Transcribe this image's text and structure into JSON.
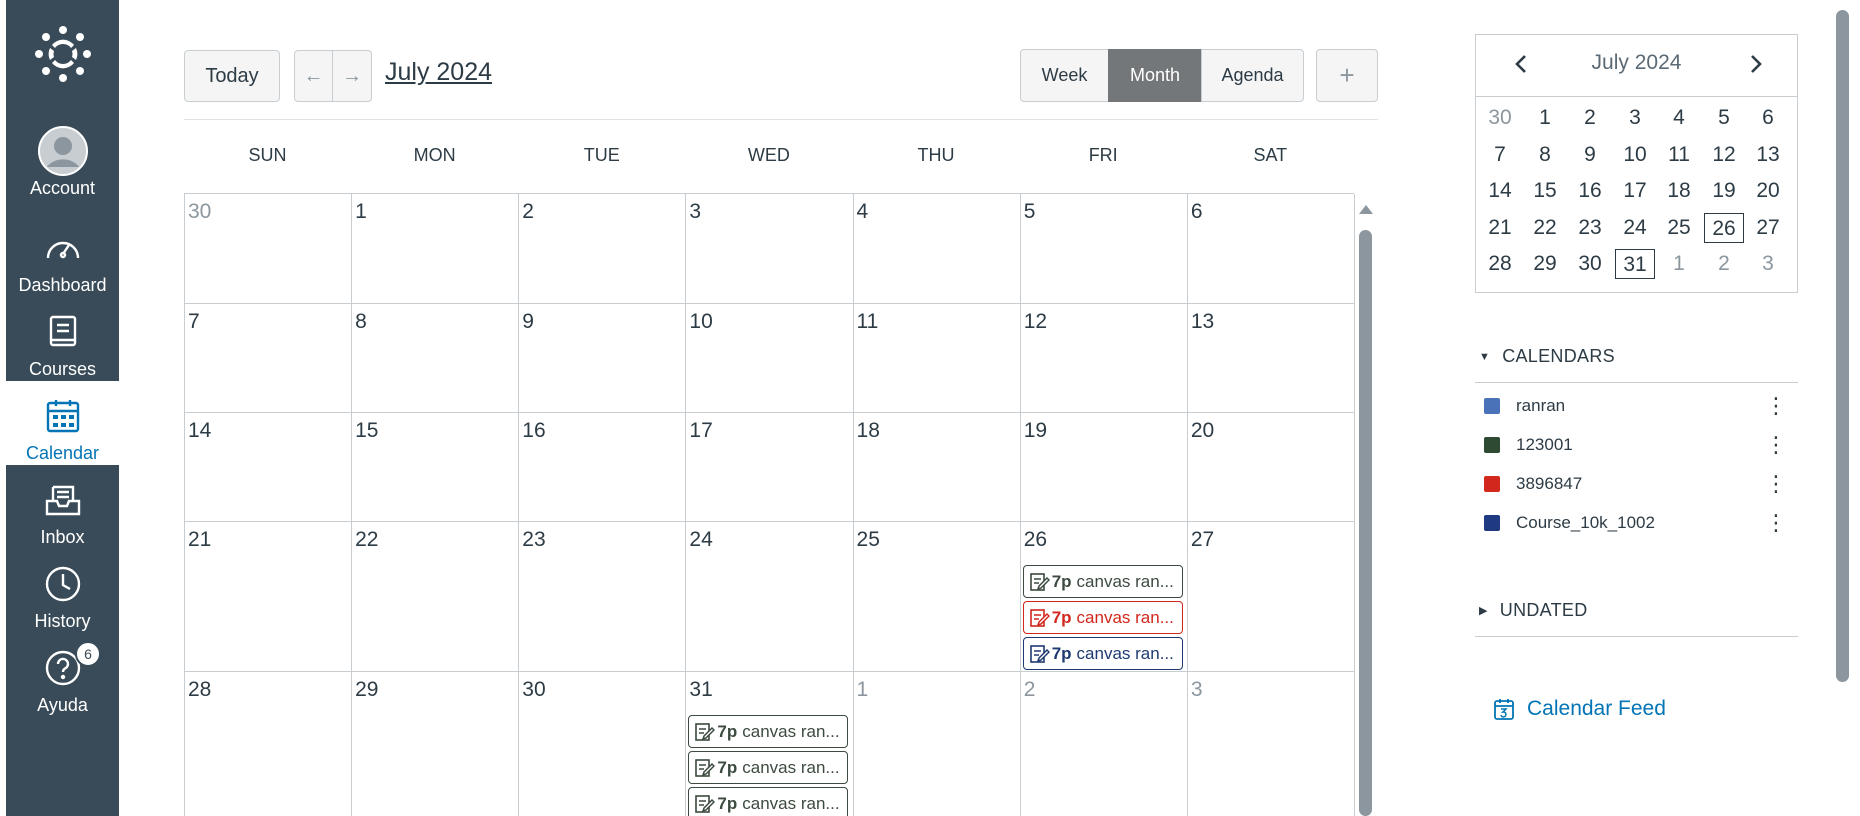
{
  "nav": {
    "items": [
      {
        "key": "account",
        "label": "Account"
      },
      {
        "key": "dashboard",
        "label": "Dashboard"
      },
      {
        "key": "courses",
        "label": "Courses"
      },
      {
        "key": "calendar",
        "label": "Calendar"
      },
      {
        "key": "inbox",
        "label": "Inbox"
      },
      {
        "key": "history",
        "label": "History"
      },
      {
        "key": "help",
        "label": "Ayuda"
      }
    ],
    "help_badge": "6"
  },
  "header": {
    "today_label": "Today",
    "prev_label": "←",
    "next_label": "→",
    "title": "July 2024",
    "week_label": "Week",
    "month_label": "Month",
    "agenda_label": "Agenda",
    "add_label": "+"
  },
  "days_of_week": [
    "SUN",
    "MON",
    "TUE",
    "WED",
    "THU",
    "FRI",
    "SAT"
  ],
  "weeks": [
    [
      {
        "d": "30",
        "other": true
      },
      {
        "d": "1"
      },
      {
        "d": "2"
      },
      {
        "d": "3"
      },
      {
        "d": "4"
      },
      {
        "d": "5"
      },
      {
        "d": "6"
      }
    ],
    [
      {
        "d": "7"
      },
      {
        "d": "8"
      },
      {
        "d": "9"
      },
      {
        "d": "10"
      },
      {
        "d": "11"
      },
      {
        "d": "12"
      },
      {
        "d": "13"
      }
    ],
    [
      {
        "d": "14"
      },
      {
        "d": "15"
      },
      {
        "d": "16"
      },
      {
        "d": "17"
      },
      {
        "d": "18"
      },
      {
        "d": "19"
      },
      {
        "d": "20"
      }
    ],
    [
      {
        "d": "21"
      },
      {
        "d": "22"
      },
      {
        "d": "23"
      },
      {
        "d": "24"
      },
      {
        "d": "25"
      },
      {
        "d": "26",
        "events": [
          {
            "time": "7p",
            "title": "canvas ran...",
            "color": "#3c4a3f"
          },
          {
            "time": "7p",
            "title": "canvas ran...",
            "color": "#d1271c"
          },
          {
            "time": "7p",
            "title": "canvas ran...",
            "color": "#1f3a73"
          }
        ]
      },
      {
        "d": "27"
      }
    ],
    [
      {
        "d": "28"
      },
      {
        "d": "29"
      },
      {
        "d": "30"
      },
      {
        "d": "31",
        "events": [
          {
            "time": "7p",
            "title": "canvas ran...",
            "color": "#3c4a3f"
          },
          {
            "time": "7p",
            "title": "canvas ran...",
            "color": "#3c4a3f"
          },
          {
            "time": "7p",
            "title": "canvas ran...",
            "color": "#3c4a3f"
          }
        ]
      },
      {
        "d": "1",
        "other": true
      },
      {
        "d": "2",
        "other": true
      },
      {
        "d": "3",
        "other": true
      }
    ]
  ],
  "minical": {
    "title": "July 2024",
    "prev_label": "‹",
    "next_label": "›",
    "weeks": [
      [
        {
          "d": "30",
          "other": true
        },
        {
          "d": "1"
        },
        {
          "d": "2"
        },
        {
          "d": "3"
        },
        {
          "d": "4"
        },
        {
          "d": "5"
        },
        {
          "d": "6"
        }
      ],
      [
        {
          "d": "7"
        },
        {
          "d": "8"
        },
        {
          "d": "9"
        },
        {
          "d": "10"
        },
        {
          "d": "11"
        },
        {
          "d": "12"
        },
        {
          "d": "13"
        }
      ],
      [
        {
          "d": "14"
        },
        {
          "d": "15"
        },
        {
          "d": "16"
        },
        {
          "d": "17"
        },
        {
          "d": "18"
        },
        {
          "d": "19"
        },
        {
          "d": "20"
        }
      ],
      [
        {
          "d": "21"
        },
        {
          "d": "22"
        },
        {
          "d": "23"
        },
        {
          "d": "24"
        },
        {
          "d": "25"
        },
        {
          "d": "26",
          "boxed": true
        },
        {
          "d": "27"
        }
      ],
      [
        {
          "d": "28"
        },
        {
          "d": "29"
        },
        {
          "d": "30"
        },
        {
          "d": "31",
          "boxed": true
        },
        {
          "d": "1",
          "other": true
        },
        {
          "d": "2",
          "other": true
        },
        {
          "d": "3",
          "other": true
        }
      ]
    ]
  },
  "calendars": {
    "title": "CALENDARS",
    "items": [
      {
        "name": "ranran",
        "color": "#4a72b8"
      },
      {
        "name": "123001",
        "color": "#2e4a33"
      },
      {
        "name": "3896847",
        "color": "#d1271c"
      },
      {
        "name": "Course_10k_1002",
        "color": "#1f3a80"
      }
    ]
  },
  "undated": {
    "title": "UNDATED"
  },
  "feed": {
    "label": "Calendar Feed"
  }
}
